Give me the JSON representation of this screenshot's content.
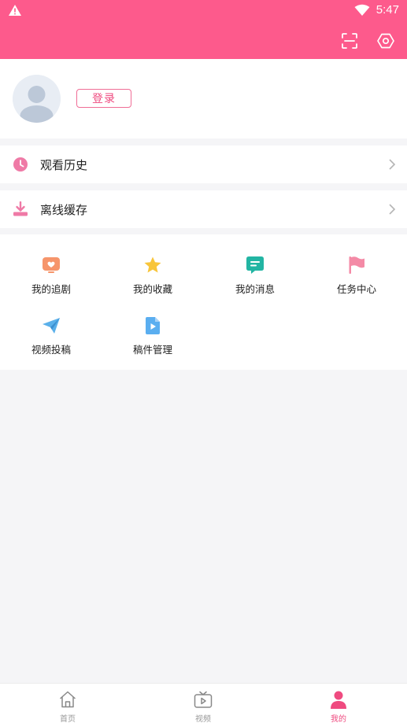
{
  "status_bar": {
    "time": "5:47"
  },
  "profile": {
    "login_label": "登录"
  },
  "menu": [
    {
      "label": "观看历史",
      "icon": "clock-icon"
    },
    {
      "label": "离线缓存",
      "icon": "download-icon"
    }
  ],
  "features": [
    {
      "label": "我的追剧",
      "icon": "heart-tv-icon"
    },
    {
      "label": "我的收藏",
      "icon": "star-icon"
    },
    {
      "label": "我的消息",
      "icon": "message-icon"
    },
    {
      "label": "任务中心",
      "icon": "flag-icon"
    },
    {
      "label": "视频投稿",
      "icon": "paper-plane-icon"
    },
    {
      "label": "稿件管理",
      "icon": "video-file-icon"
    }
  ],
  "nav": [
    {
      "label": "首页",
      "icon": "home-icon"
    },
    {
      "label": "视频",
      "icon": "tv-icon"
    },
    {
      "label": "我的",
      "icon": "user-icon",
      "active": true
    }
  ],
  "colors": {
    "accent": "#fd5a8c",
    "background": "#f5f5f7"
  }
}
